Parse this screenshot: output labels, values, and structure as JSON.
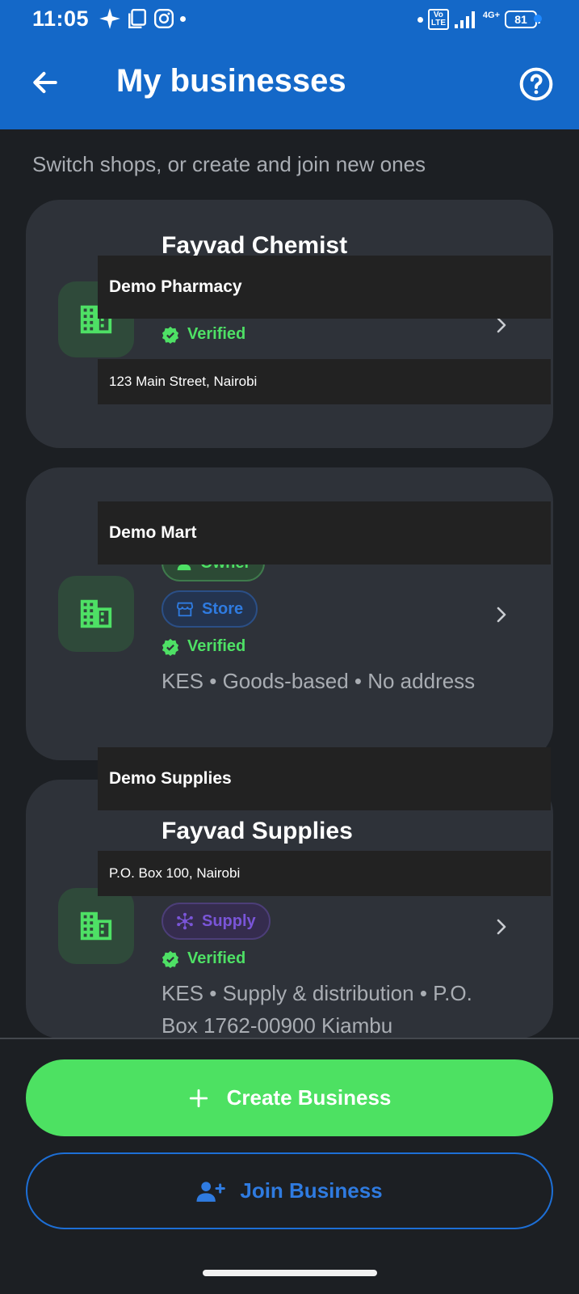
{
  "status_bar": {
    "time": "11:05",
    "network": "4G+",
    "volte": "Vo LTE",
    "battery": "81",
    "icons_left": [
      "sparkle-icon",
      "screenshot-icon",
      "instagram-icon",
      "dot-icon"
    ],
    "icons_right": [
      "dot-icon",
      "volte-icon",
      "signal-icon",
      "battery-icon"
    ]
  },
  "app_bar": {
    "title": "My businesses",
    "back_icon": "arrow-left-icon",
    "help_icon": "help-circle-icon",
    "background": "#1468c8"
  },
  "subtitle": "Switch shops, or create and join new ones",
  "businesses": [
    {
      "title_partial": "Fayvad Chemist",
      "overlay_name": "Demo Pharmacy",
      "overlay_address": "123 Main Street, Nairobi",
      "verified": "Verified"
    },
    {
      "overlay_name": "Demo Mart",
      "chips": [
        {
          "label": "Owner",
          "icon": "person-icon"
        },
        {
          "label": "Store",
          "icon": "store-icon"
        }
      ],
      "verified": "Verified",
      "meta": "KES • Goods-based • No address"
    },
    {
      "overlay_name": "Demo Supplies",
      "title": "Fayvad Supplies",
      "overlay_address": "P.O. Box 100, Nairobi",
      "chips": [
        {
          "label": "Supply",
          "icon": "network-icon"
        }
      ],
      "verified": "Verified",
      "meta": "KES • Supply & distribution • P.O. Box 1762-00900 Kiambu"
    }
  ],
  "actions": {
    "create_label": "Create Business",
    "join_label": "Join Business"
  },
  "colors": {
    "accent_green": "#4de162",
    "accent_blue": "#1468c8",
    "verified_green": "#4ee065",
    "card_bg": "#2e3239",
    "page_bg": "#1c1f23"
  }
}
